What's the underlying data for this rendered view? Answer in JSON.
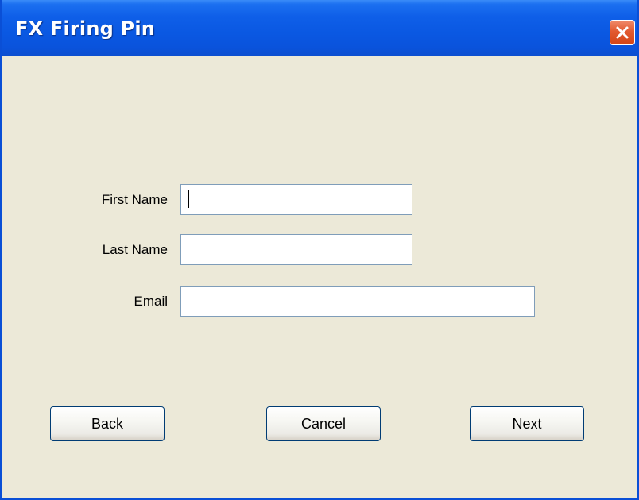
{
  "window": {
    "title": "FX Firing Pin",
    "close_icon": "close-icon"
  },
  "form": {
    "first_name": {
      "label": "First Name",
      "value": "",
      "placeholder": ""
    },
    "last_name": {
      "label": "Last Name",
      "value": "",
      "placeholder": ""
    },
    "email": {
      "label": "Email",
      "value": "",
      "placeholder": ""
    }
  },
  "buttons": {
    "back": "Back",
    "cancel": "Cancel",
    "next": "Next"
  },
  "colors": {
    "titlebar": "#0a58e2",
    "window_bg": "#ece9d8",
    "close_button": "#e25a30",
    "field_border": "#7f9db9",
    "button_border": "#003c74"
  }
}
